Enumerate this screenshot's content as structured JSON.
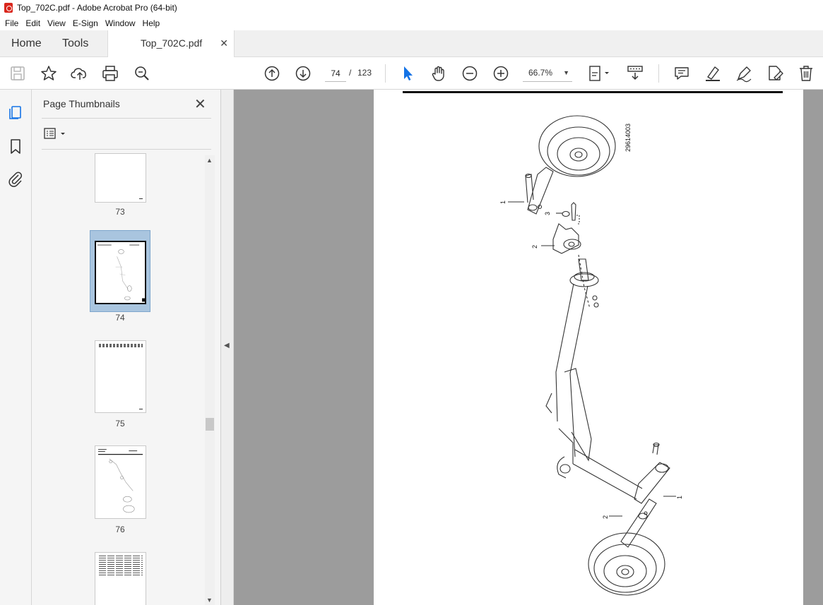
{
  "window": {
    "title": "Top_702C.pdf - Adobe Acrobat Pro (64-bit)"
  },
  "menu": [
    "File",
    "Edit",
    "View",
    "E-Sign",
    "Window",
    "Help"
  ],
  "tabs": {
    "home": "Home",
    "tools": "Tools",
    "document": "Top_702C.pdf"
  },
  "toolbar": {
    "current_page": "74",
    "page_separator": "/",
    "total_pages": "123",
    "zoom": "66.7%",
    "icons": [
      "save-icon",
      "star-icon",
      "upload-icon",
      "print-icon",
      "zoom-search-icon",
      "page-up-icon",
      "page-down-icon",
      "select-cursor-icon",
      "hand-icon",
      "zoom-out-icon",
      "zoom-in-icon",
      "page-view-icon",
      "scroll-mode-icon",
      "comment-icon",
      "highlight-icon",
      "draw-icon",
      "fill-sign-icon",
      "delete-icon"
    ]
  },
  "sidebar": {
    "title": "Page Thumbnails",
    "thumbnails": [
      {
        "label": "73",
        "selected": false
      },
      {
        "label": "74",
        "selected": true
      },
      {
        "label": "75",
        "selected": false
      },
      {
        "label": "76",
        "selected": false
      },
      {
        "label": "",
        "selected": false
      }
    ]
  },
  "document": {
    "drawing_id": "29614003",
    "callouts": [
      "1",
      "3",
      "2",
      "2",
      "1"
    ]
  },
  "colors": {
    "accent": "#1473e6",
    "selection": "#a9c5df",
    "pdf_red": "#d9261c"
  }
}
